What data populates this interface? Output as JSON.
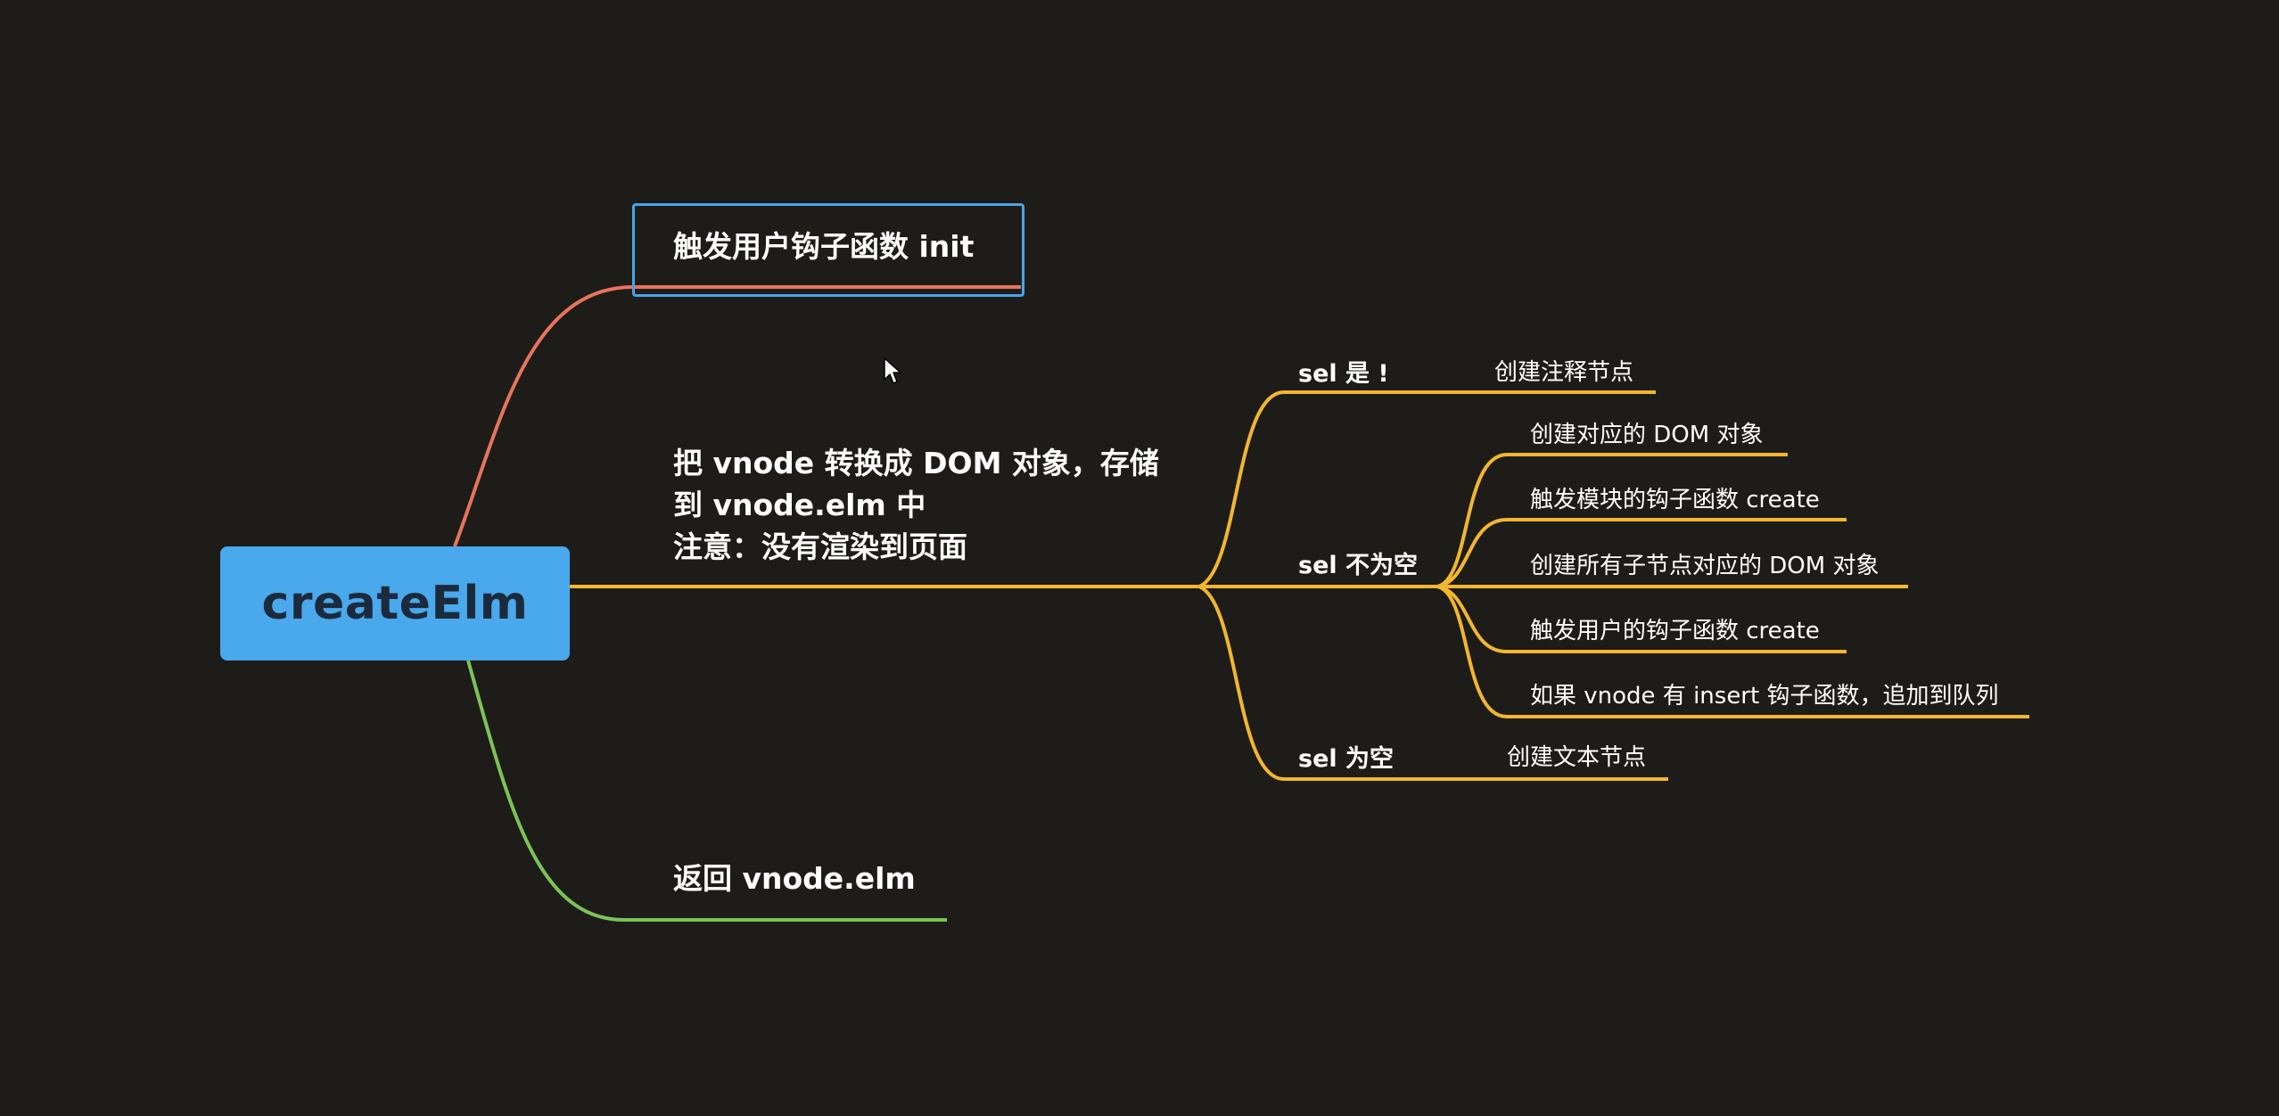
{
  "mindmap": {
    "root": {
      "label": "createElm"
    },
    "branches": [
      {
        "label": "触发用户钩子函数 init",
        "color": "#e8745c",
        "selected": true
      },
      {
        "label_lines": [
          "把 vnode 转换成 DOM 对象，存储",
          "到 vnode.elm 中",
          "注意：没有渲染到页面"
        ],
        "color": "#f2b62f",
        "children": [
          {
            "label": "sel 是 !",
            "children": [
              {
                "label": "创建注释节点"
              }
            ]
          },
          {
            "label": "sel 不为空",
            "children": [
              {
                "label": "创建对应的 DOM 对象"
              },
              {
                "label": "触发模块的钩子函数 create"
              },
              {
                "label": "创建所有子节点对应的 DOM 对象"
              },
              {
                "label": "触发用户的钩子函数 create"
              },
              {
                "label": "如果 vnode 有 insert 钩子函数，追加到队列"
              }
            ]
          },
          {
            "label": "sel 为空",
            "children": [
              {
                "label": "创建文本节点"
              }
            ]
          }
        ]
      },
      {
        "label": "返回 vnode.elm",
        "color": "#7cc356"
      }
    ]
  },
  "colors": {
    "background": "#1e1c19",
    "root_fill": "#4aa8ec",
    "root_text": "#1b2a3c",
    "selection_border": "#48a4e8"
  },
  "icons": {
    "cursor": "mouse-pointer-icon"
  }
}
